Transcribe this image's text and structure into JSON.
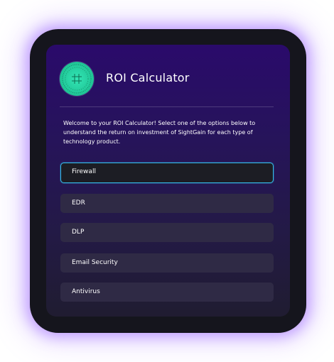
{
  "app": {
    "title": "ROI Calculator",
    "intro": "Welcome to your ROI Calculator! Select one of the options below to understand the return on investment of SightGain for each type of technology product."
  },
  "logo": {
    "icon": "sightgain-logo-icon",
    "color": "#22c99a"
  },
  "options": [
    {
      "label": "Firewall",
      "selected": true
    },
    {
      "label": "EDR",
      "selected": false
    },
    {
      "label": "DLP",
      "selected": false
    },
    {
      "label": "Email Security",
      "selected": false
    },
    {
      "label": "Antivirus",
      "selected": false
    }
  ],
  "colors": {
    "accent": "#35b9e6",
    "panel_top": "#2a0a6b",
    "frame": "#15151d"
  }
}
